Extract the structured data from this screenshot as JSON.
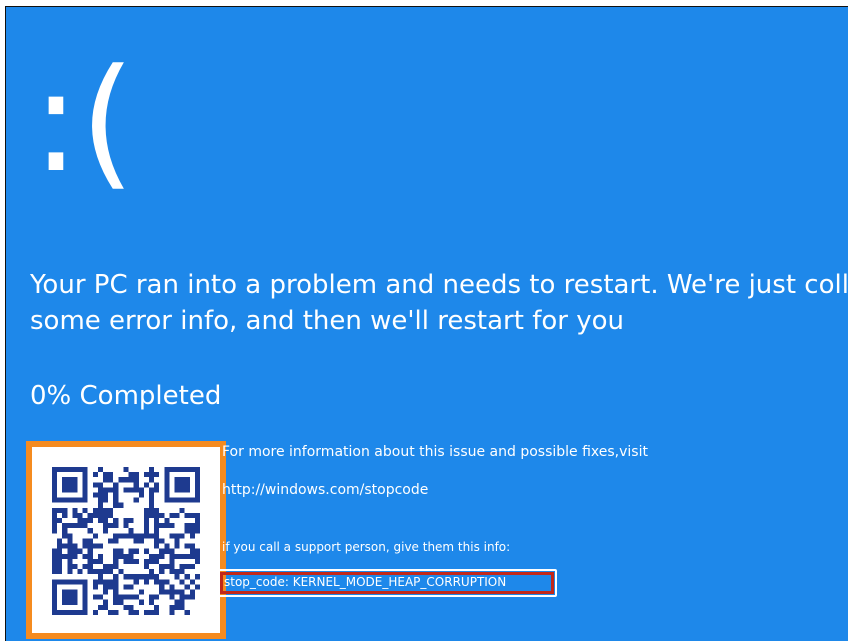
{
  "screen": {
    "face": ":(",
    "message_line1": "Your PC ran into a problem and needs to restart. We're just collecting",
    "message_line2": "some error info, and then we'll restart for you",
    "progress_text": "0% Completed",
    "info_more": "For more information about this issue and possible fixes,visit",
    "info_url": "http://windows.com/stopcode",
    "info_support": "if you call a support person, give them this info:",
    "stop_code": "stop_code: KERNEL_MODE_HEAP_CORRUPTION"
  },
  "qr_code": {
    "icon": "qr-code-icon"
  },
  "colors": {
    "screen_background": "#1e88ea",
    "text": "#ffffff",
    "qr_highlight": "#f58b1f",
    "stop_code_highlight": "#c2281a"
  }
}
